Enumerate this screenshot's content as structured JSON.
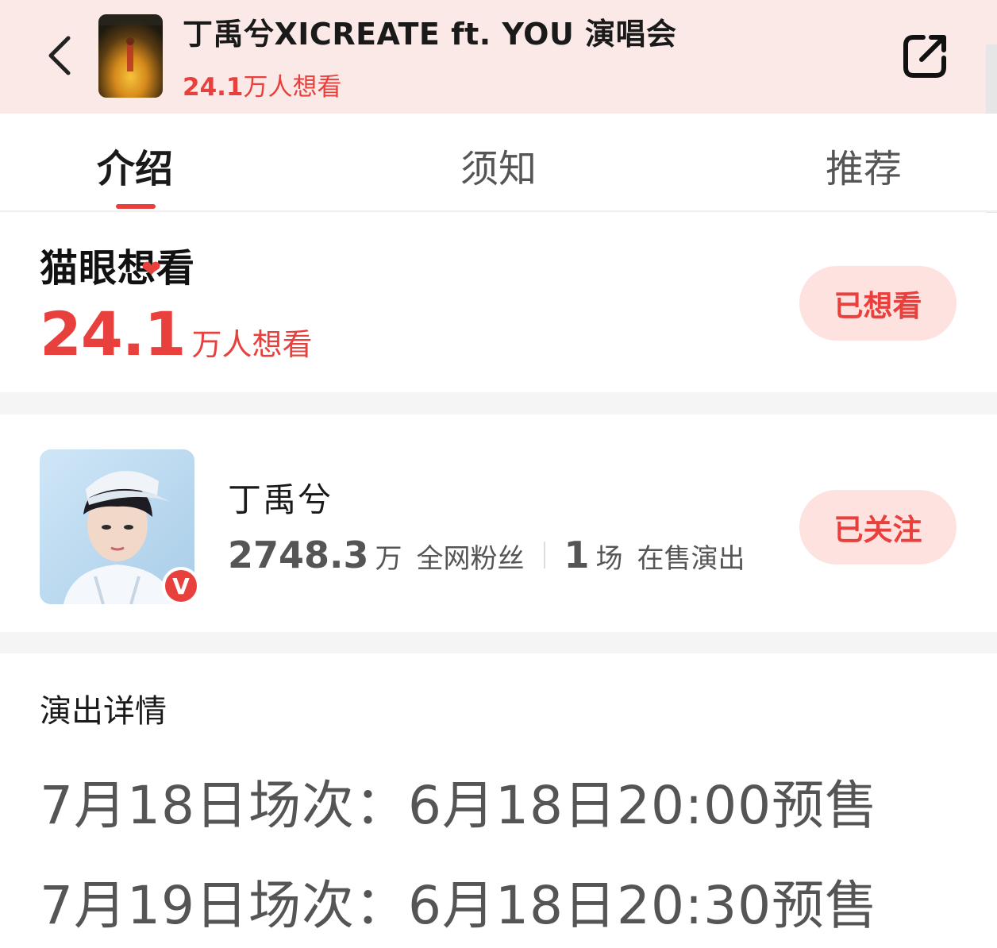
{
  "header": {
    "title": "丁禹兮XICREATE ft. YOU 演唱会",
    "want_count_number": "24.1",
    "want_count_unit": "万人想看",
    "back_icon": "chevron-left-icon",
    "share_icon": "share-icon"
  },
  "tabs": [
    {
      "label": "介绍",
      "active": true
    },
    {
      "label": "须知",
      "active": false
    },
    {
      "label": "推荐",
      "active": false
    }
  ],
  "want_section": {
    "logo_text": "猫眼想看",
    "count_number": "24.1",
    "count_unit": "万人想看",
    "button_label": "已想看"
  },
  "artist": {
    "name": "丁禹兮",
    "fans_number": "2748.3",
    "fans_unit": "万",
    "fans_label": "全网粉丝",
    "shows_number": "1",
    "shows_unit": "场",
    "shows_label": "在售演出",
    "verified_badge": "V",
    "follow_button_label": "已关注"
  },
  "details": {
    "title": "演出详情",
    "lines": [
      "7月18日场次：6月18日20:00预售",
      "7月19日场次：6月18日20:30预售"
    ]
  },
  "colors": {
    "accent": "#e8403d",
    "header_bg": "#fbe9e8",
    "pill_bg": "#fde2e0"
  }
}
